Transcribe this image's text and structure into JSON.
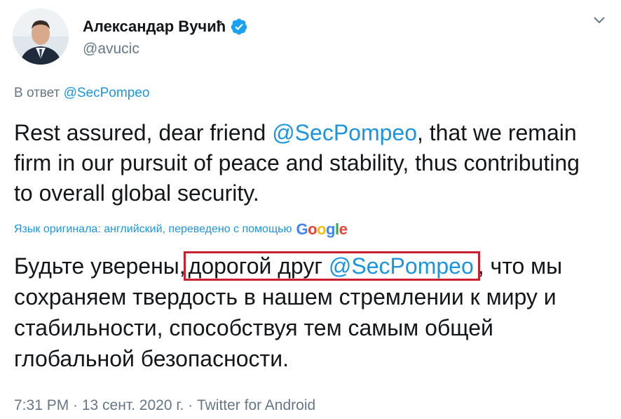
{
  "author": {
    "display_name": "Александар Вучић",
    "handle": "@avucic"
  },
  "reply_to": {
    "prefix": "В ответ",
    "mention": "@SecPompeo"
  },
  "tweet": {
    "text_before_mention": "Rest assured, dear friend ",
    "mention": "@SecPompeo",
    "text_after_mention": ", that we remain firm in our pursuit of peace and stability, thus contributing to overall global security."
  },
  "translation": {
    "note": "Язык оригинала: английский, переведено с помощью",
    "provider_letters": [
      "G",
      "o",
      "o",
      "g",
      "l",
      "e"
    ],
    "provider_colors": [
      "#4285F4",
      "#EA4335",
      "#FBBC05",
      "#4285F4",
      "#34A853",
      "#EA4335"
    ],
    "text_before_highlight": "Будьте уверены,",
    "highlight_text": "дорогой друг ",
    "highlight_mention": "@SecPompeo",
    "text_after_highlight": ", что мы сохраняем твердость в нашем стремлении к миру и стабильности, способствуя тем самым общей глобальной безопасности."
  },
  "meta": {
    "timestamp": "7:31 PM · 13 сент. 2020 г. · Twitter for Android"
  },
  "colors": {
    "link": "#1b95e0",
    "secondary_text": "#657786",
    "verified_badge": "#1da1f2",
    "highlight_box": "#c9202e"
  },
  "icons": {
    "verified": "verified-badge-icon",
    "menu": "chevron-down-icon"
  }
}
